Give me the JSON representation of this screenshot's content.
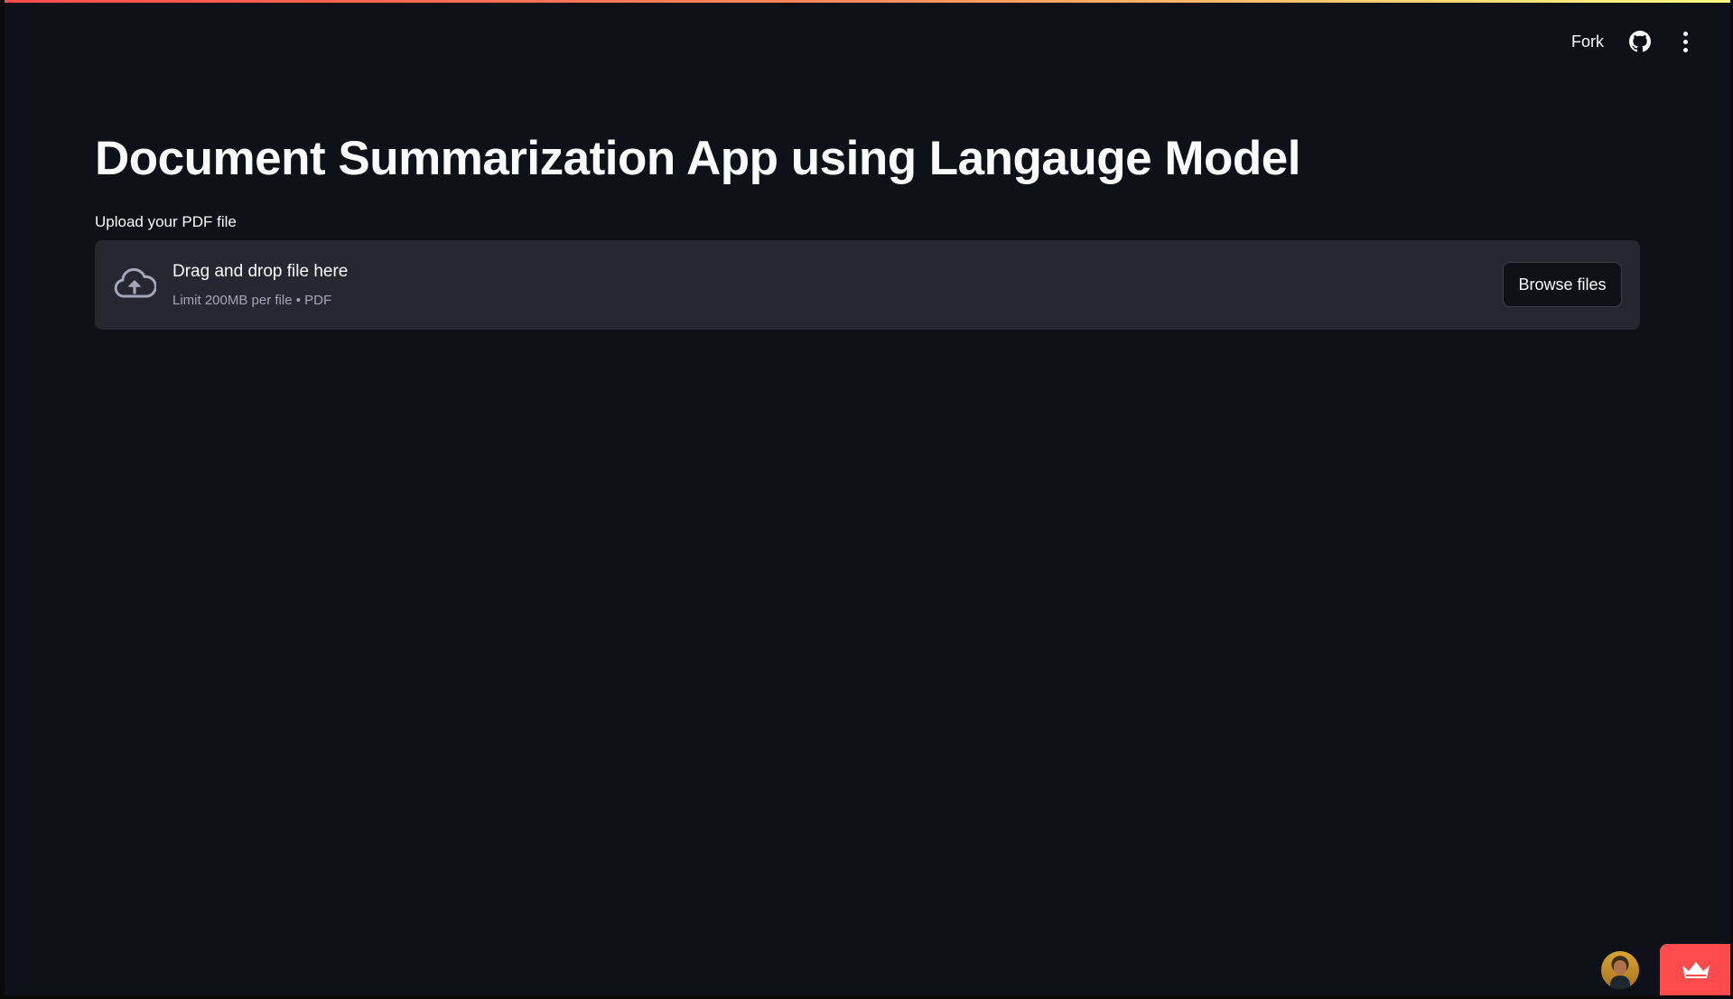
{
  "header": {
    "fork_label": "Fork",
    "github_icon": "github-icon",
    "menu_icon": "kebab-menu-icon"
  },
  "main": {
    "title": "Document Summarization App using Langauge Model",
    "uploader": {
      "label": "Upload your PDF file",
      "drop_text": "Drag and drop file here",
      "limit_text": "Limit 200MB per file • PDF",
      "browse_label": "Browse files",
      "icon": "cloud-upload-icon"
    }
  },
  "footer": {
    "avatar_icon": "user-avatar",
    "badge_icon": "crown-icon"
  },
  "colors": {
    "background": "#0e1117",
    "surface": "#262730",
    "accent": "#ff4b4b",
    "text": "#fafafa",
    "muted_text": "#a3a8b8"
  }
}
